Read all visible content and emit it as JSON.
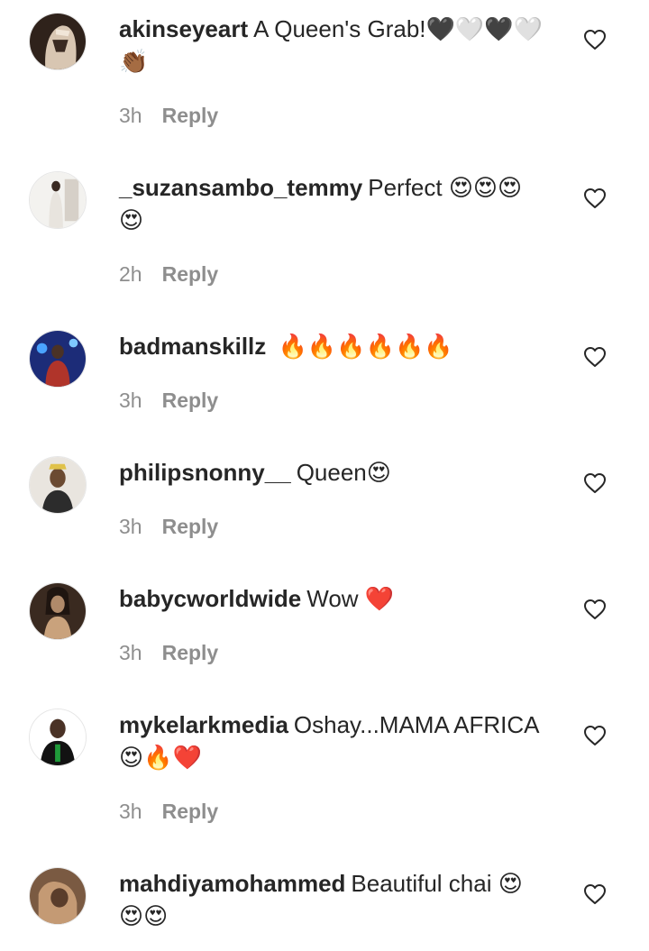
{
  "comments": [
    {
      "username": "akinseyeart",
      "text": "A Queen's Grab!🖤🤍🖤🤍👏🏾",
      "time": "3h",
      "reply_label": "Reply",
      "avatar_colors": [
        "#3b2a22",
        "#d9c9b7"
      ]
    },
    {
      "username": "_suzansambo_temmy",
      "text": "Perfect 😍😍😍😍",
      "time": "2h",
      "reply_label": "Reply",
      "avatar_colors": [
        "#f2f2f0",
        "#c8c2bb"
      ]
    },
    {
      "username": "badmanskillz",
      "text": " 🔥🔥🔥🔥🔥🔥",
      "time": "3h",
      "reply_label": "Reply",
      "avatar_colors": [
        "#1b2a6b",
        "#b23b2e"
      ]
    },
    {
      "username": "philipsnonny__",
      "text": "Queen😍",
      "time": "3h",
      "reply_label": "Reply",
      "avatar_colors": [
        "#e6e2dc",
        "#6b4a32"
      ]
    },
    {
      "username": "babycworldwide",
      "text": "Wow ❤️",
      "time": "3h",
      "reply_label": "Reply",
      "avatar_colors": [
        "#b08a6a",
        "#3a2a20"
      ]
    },
    {
      "username": "mykelarkmedia",
      "text": "Oshay...MAMA AFRICA😍🔥❤️",
      "time": "3h",
      "reply_label": "Reply",
      "avatar_colors": [
        "#ffffff",
        "#111111"
      ]
    },
    {
      "username": "mahdiyamohammed",
      "text": "Beautiful chai 😍😍😍",
      "time": "",
      "reply_label": "",
      "avatar_colors": [
        "#c49a74",
        "#5a3d2b"
      ]
    }
  ]
}
